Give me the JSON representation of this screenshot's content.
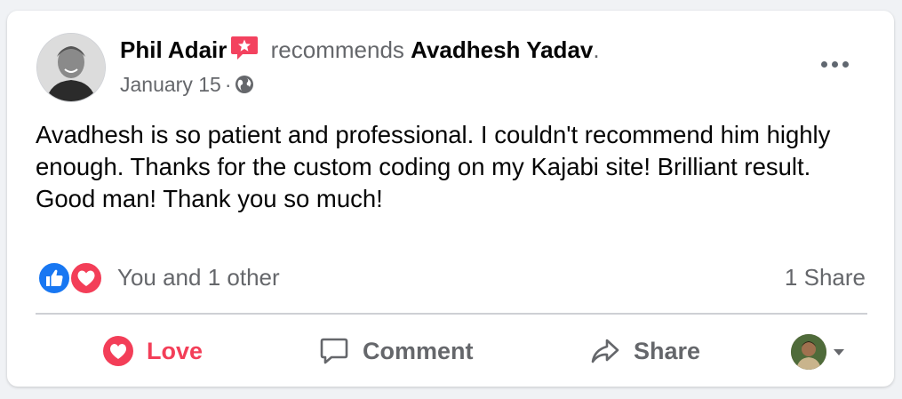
{
  "post": {
    "author": "Phil Adair",
    "verb": "recommends",
    "target": "Avadhesh Yadav",
    "punctuation": ".",
    "date": "January 15",
    "separator": "·",
    "privacy_icon": "globe-icon",
    "more_icon": "more-options-icon",
    "body": "Avadhesh is so patient and professional. I couldn't recommend him highly enough. Thanks for the custom coding on my Kajabi site! Brilliant result. Good man! Thank you so much!"
  },
  "reactions": {
    "icons": [
      "like-reaction-icon",
      "love-reaction-icon"
    ],
    "summary": "You and 1 other",
    "shares": "1 Share"
  },
  "actions": {
    "love_label": "Love",
    "comment_label": "Comment",
    "share_label": "Share"
  },
  "colors": {
    "love": "#f33e58",
    "like": "#1877f2",
    "recommend_badge": "#f3425f",
    "secondary_text": "#65676b",
    "primary_text": "#050505"
  }
}
